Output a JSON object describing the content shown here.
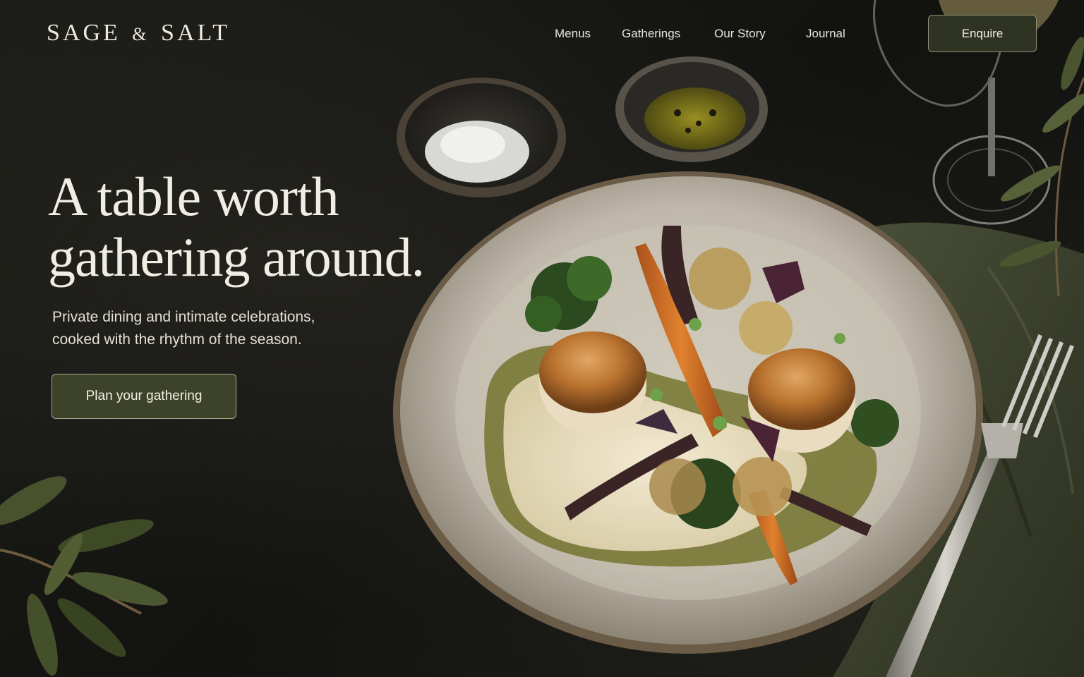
{
  "brand": {
    "name_part1": "SAGE",
    "ampersand": "&",
    "name_part2": "SALT"
  },
  "nav": {
    "items": [
      {
        "label": "Menus"
      },
      {
        "label": "Gatherings"
      },
      {
        "label": "Our Story"
      },
      {
        "label": "Journal"
      }
    ],
    "enquire_label": "Enquire"
  },
  "hero": {
    "headline_line1": "A table worth",
    "headline_line2": "gathering around.",
    "subtext_line1": "Private dining and intimate celebrations,",
    "subtext_line2": "cooked with the rhythm of the season.",
    "cta_label": "Plan your gathering"
  },
  "colors": {
    "background": "#141411",
    "text_cream": "#f1ede4",
    "button_olive": "#3d4328",
    "button_border": "#a9a690"
  }
}
